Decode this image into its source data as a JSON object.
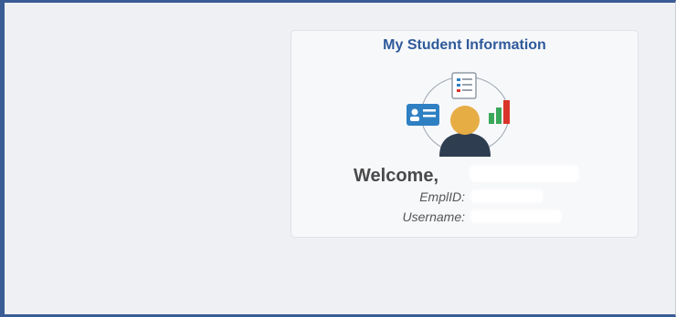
{
  "card": {
    "title": "My Student Information",
    "welcome_label": "Welcome,",
    "emplid_label": "EmplID:",
    "username_label": "Username:"
  },
  "icons": [
    "document-icon",
    "id-card-icon",
    "user-avatar-icon",
    "bar-chart-icon"
  ],
  "colors": {
    "title_blue": "#2f5a9b",
    "frame_border": "#3a5c94",
    "avatar_skin": "#e7ad45",
    "avatar_body": "#2e3d4f",
    "id_card_blue": "#2f80c2",
    "bar_green": "#3aa85a",
    "bar_red": "#d9342b"
  }
}
